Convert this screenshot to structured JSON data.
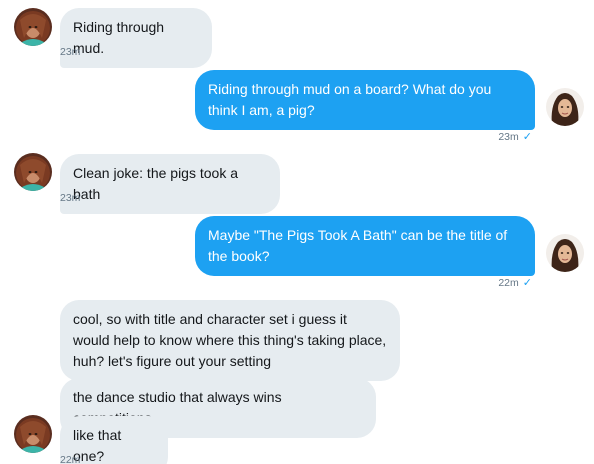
{
  "messages": [
    {
      "side": "left",
      "text": "Riding through mud.",
      "time": "23m"
    },
    {
      "side": "right",
      "text": "Riding through mud on a board? What do you think I am, a pig?",
      "time": "23m"
    },
    {
      "side": "left",
      "text": "Clean joke: the pigs took a bath",
      "time": "23m"
    },
    {
      "side": "right",
      "text": "Maybe \"The Pigs Took A Bath\" can be the title of the book?",
      "time": "22m"
    },
    {
      "side": "left",
      "text": "cool, so with title and character set i guess it would help to know where this thing's taking place, huh? let's figure out your setting"
    },
    {
      "side": "left",
      "text": "the dance studio that always wins competitions"
    },
    {
      "side": "left",
      "text": "like that one?",
      "time": "22m"
    }
  ],
  "read_receipt_icon": "checkmark-icon",
  "colors": {
    "sent_bubble": "#1da1f2",
    "received_bubble": "#e6ecf0",
    "timestamp": "#657786"
  }
}
